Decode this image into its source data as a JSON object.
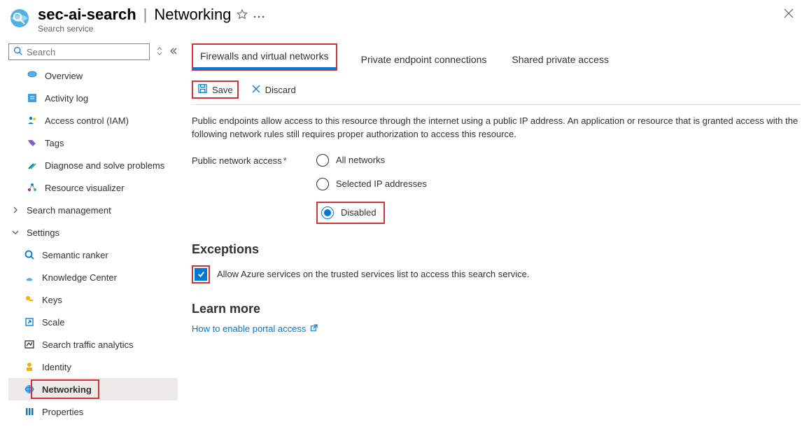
{
  "header": {
    "resource_name": "sec-ai-search",
    "blade_title": "Networking",
    "resource_type": "Search service"
  },
  "sidebar": {
    "search_placeholder": "Search",
    "items": [
      {
        "label": "Overview",
        "icon": "overview"
      },
      {
        "label": "Activity log",
        "icon": "activitylog"
      },
      {
        "label": "Access control (IAM)",
        "icon": "iam"
      },
      {
        "label": "Tags",
        "icon": "tags"
      },
      {
        "label": "Diagnose and solve problems",
        "icon": "diagnose"
      },
      {
        "label": "Resource visualizer",
        "icon": "visualizer"
      }
    ],
    "group_search_mgmt": "Search management",
    "group_settings": "Settings",
    "settings_children": [
      {
        "label": "Semantic ranker",
        "icon": "semantic"
      },
      {
        "label": "Knowledge Center",
        "icon": "knowledge"
      },
      {
        "label": "Keys",
        "icon": "keys"
      },
      {
        "label": "Scale",
        "icon": "scale"
      },
      {
        "label": "Search traffic analytics",
        "icon": "analytics"
      },
      {
        "label": "Identity",
        "icon": "identity"
      },
      {
        "label": "Networking",
        "icon": "networking"
      },
      {
        "label": "Properties",
        "icon": "properties"
      }
    ]
  },
  "tabs": {
    "firewalls": "Firewalls and virtual networks",
    "private_ep": "Private endpoint connections",
    "shared_pa": "Shared private access"
  },
  "commands": {
    "save": "Save",
    "discard": "Discard"
  },
  "description": "Public endpoints allow access to this resource through the internet using a public IP address. An application or resource that is granted access with the following network rules still requires proper authorization to access this resource.",
  "pna": {
    "label": "Public network access",
    "options": {
      "all": "All networks",
      "selected": "Selected IP addresses",
      "disabled": "Disabled"
    }
  },
  "exceptions": {
    "heading": "Exceptions",
    "allow_trusted": "Allow Azure services on the trusted services list to access this search service."
  },
  "learn_more": {
    "heading": "Learn more",
    "link": "How to enable portal access"
  }
}
